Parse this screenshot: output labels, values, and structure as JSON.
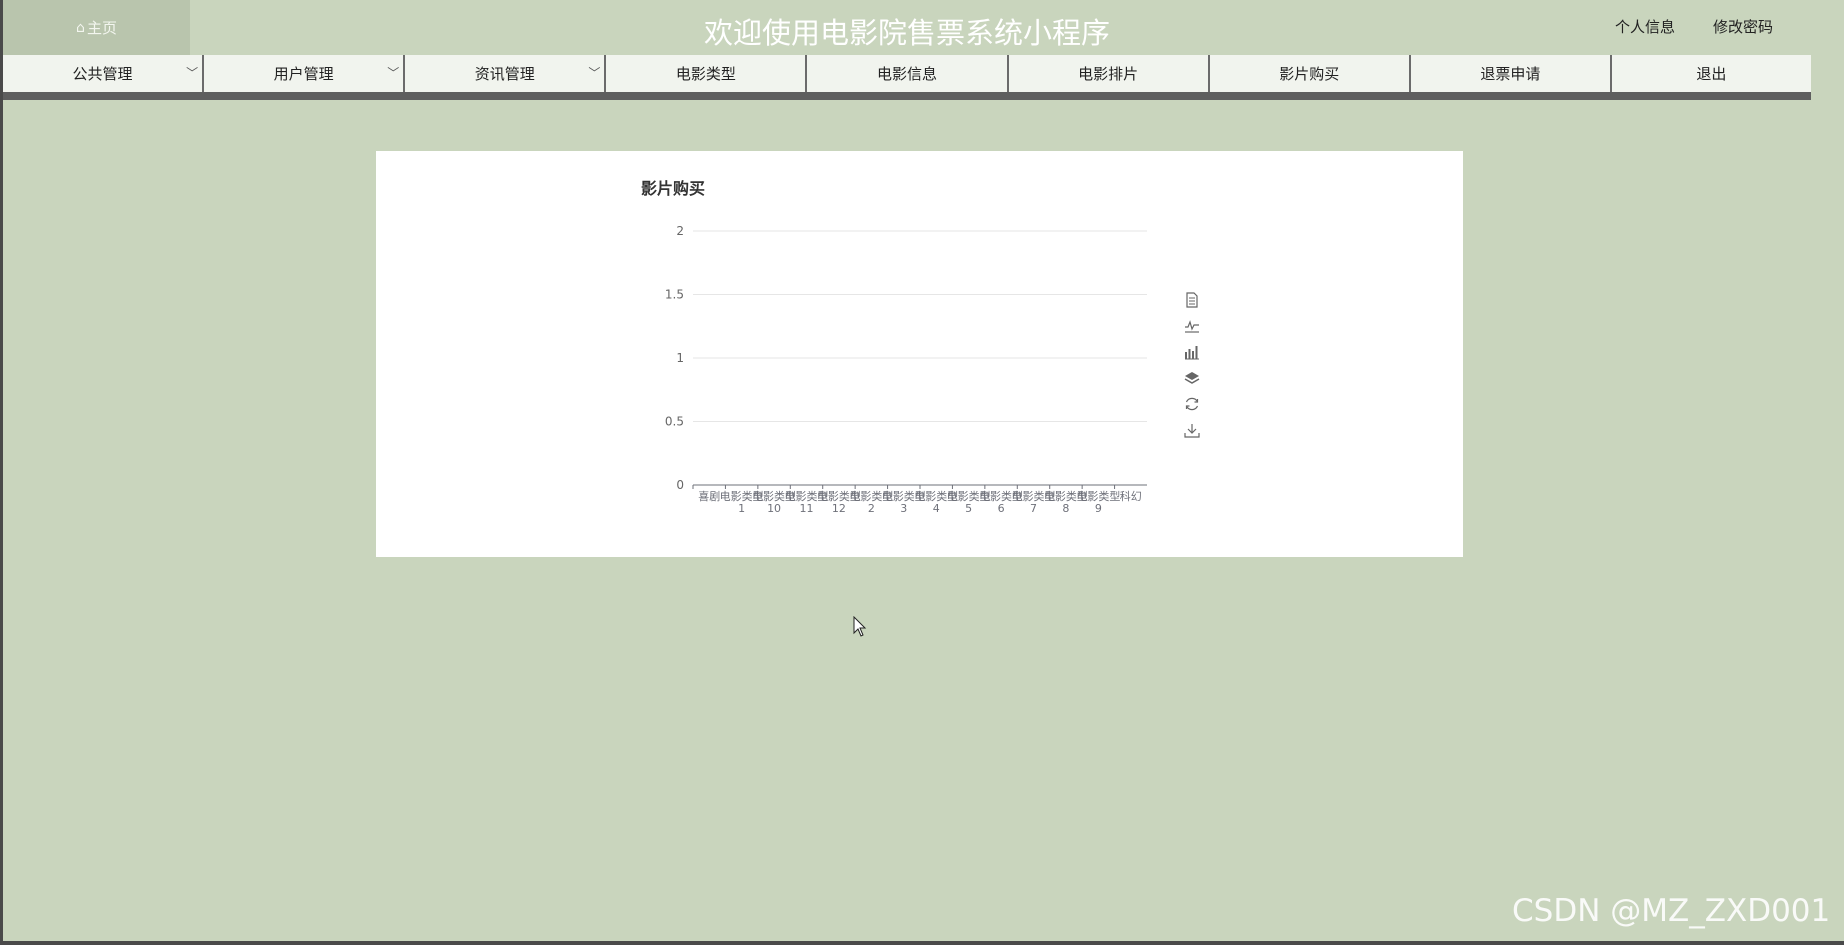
{
  "header": {
    "home_label": "主页",
    "title": "欢迎使用电影院售票系统小程序",
    "profile_label": "个人信息",
    "password_label": "修改密码"
  },
  "nav": [
    {
      "label": "公共管理",
      "dropdown": true
    },
    {
      "label": "用户管理",
      "dropdown": true
    },
    {
      "label": "资讯管理",
      "dropdown": true
    },
    {
      "label": "电影类型",
      "dropdown": false
    },
    {
      "label": "电影信息",
      "dropdown": false
    },
    {
      "label": "电影排片",
      "dropdown": false
    },
    {
      "label": "影片购买",
      "dropdown": false
    },
    {
      "label": "退票申请",
      "dropdown": false
    },
    {
      "label": "退出",
      "dropdown": false
    }
  ],
  "chart_data": {
    "type": "bar",
    "title": "影片购买",
    "categories": [
      "喜剧",
      "电影类型1",
      "电影类型10",
      "电影类型11",
      "电影类型12",
      "电影类型2",
      "电影类型3",
      "电影类型4",
      "电影类型5",
      "电影类型6",
      "电影类型7",
      "电影类型8",
      "电影类型9",
      "科幻"
    ],
    "values": [
      0,
      0,
      0,
      0,
      0,
      0,
      0,
      0,
      0,
      0,
      0,
      0,
      0,
      0
    ],
    "ylim": [
      0,
      2
    ],
    "yticks": [
      "0",
      "0.5",
      "1",
      "1.5",
      "2"
    ],
    "grid": true,
    "toolbox": [
      "data-view",
      "line-chart",
      "bar-chart",
      "stack",
      "restore",
      "save-image"
    ]
  },
  "watermark": "CSDN @MZ_ZXD001",
  "colors": {
    "background": "#c9d5bd",
    "nav_background": "#f1f4ee",
    "home_background": "#b9c5ad"
  }
}
